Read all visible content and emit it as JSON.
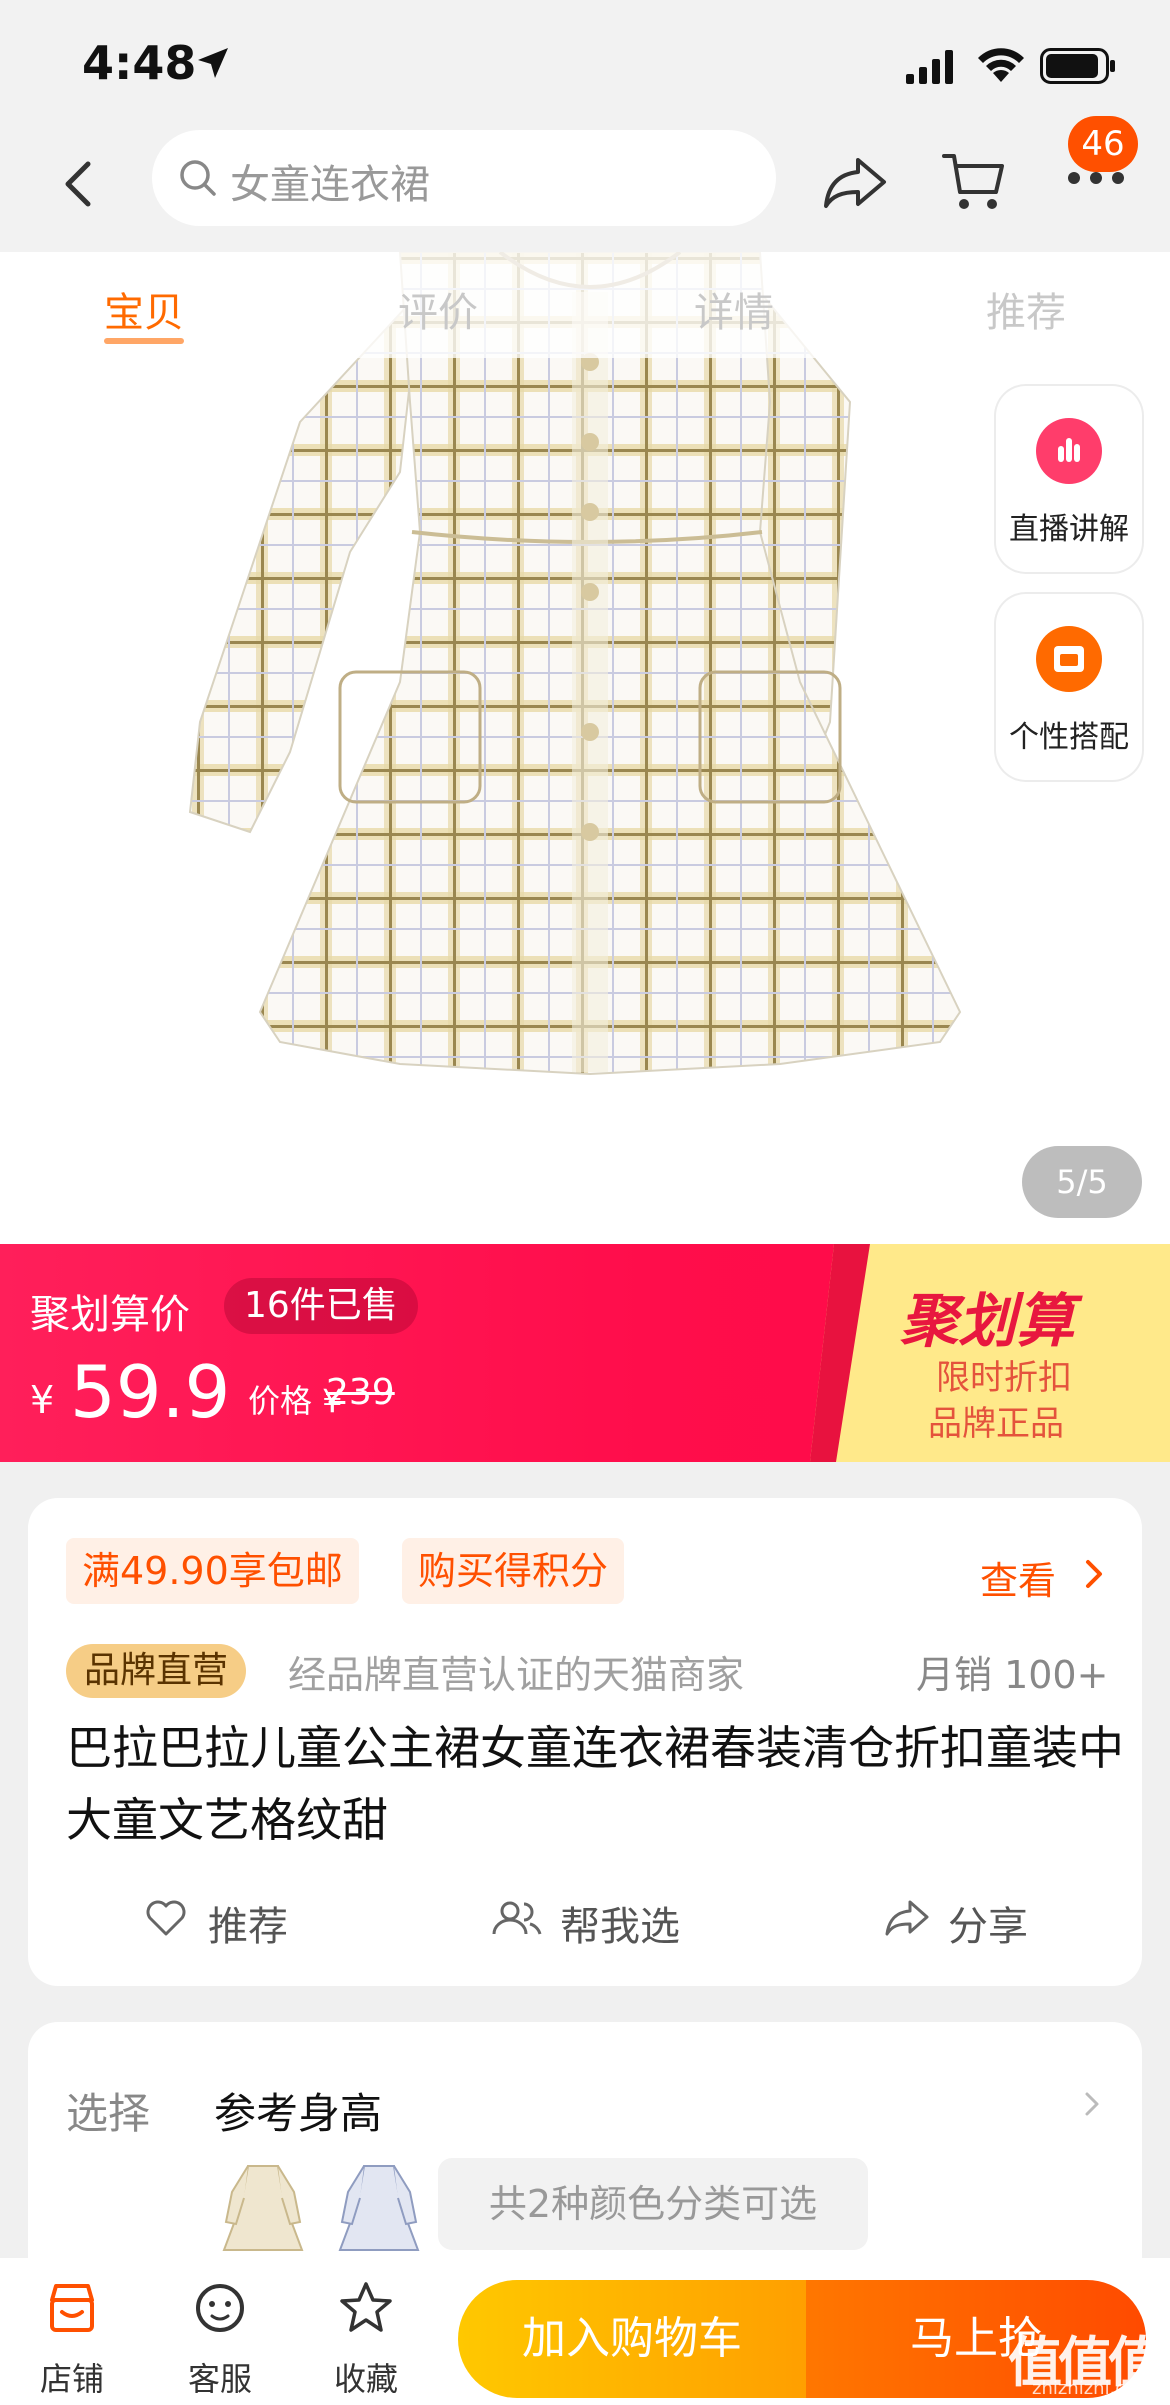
{
  "status": {
    "time": "4:48"
  },
  "nav": {
    "search_placeholder": "女童连衣裙",
    "cart_badge": "46"
  },
  "tabs": [
    {
      "label": "宝贝",
      "active": true
    },
    {
      "label": "评价",
      "active": false
    },
    {
      "label": "详情",
      "active": false
    },
    {
      "label": "推荐",
      "active": false
    }
  ],
  "side_buttons": {
    "live": "直播讲解",
    "match": "个性搭配"
  },
  "gallery": {
    "pager": "5/5"
  },
  "promo": {
    "label": "聚划算价",
    "sold": "16件已售",
    "currency": "¥",
    "price": "59.9",
    "original_label": "价格 ¥",
    "original_price": "239",
    "brand": "聚划算",
    "tagline1": "限时折扣",
    "tagline2": "品牌正品"
  },
  "info": {
    "chip_shipping": "满49.90享包邮",
    "chip_points": "购买得积分",
    "view": "查看",
    "brand_tag": "品牌直营",
    "brand_text": "经品牌直营认证的天猫商家",
    "sales": "月销 100+",
    "title": "巴拉巴拉儿童公主裙女童连衣裙春装清仓折扣童装中大童文艺格纹甜",
    "actions": [
      "推荐",
      "帮我选",
      "分享"
    ]
  },
  "select": {
    "key": "选择",
    "value": "参考身高",
    "colors_note": "共2种颜色分类可选"
  },
  "bottom": {
    "shop": "店铺",
    "service": "客服",
    "favorite": "收藏",
    "add_to_cart": "加入购物车",
    "buy_now": "马上抢"
  },
  "watermark": {
    "main": "值值值",
    "sub": "zhizhizhi.com"
  },
  "colors": {
    "accent": "#ff5000",
    "promo_red": "#ff1f5a",
    "cart_yellow": "#ffc800",
    "buy_orange": "#ff4a00"
  }
}
